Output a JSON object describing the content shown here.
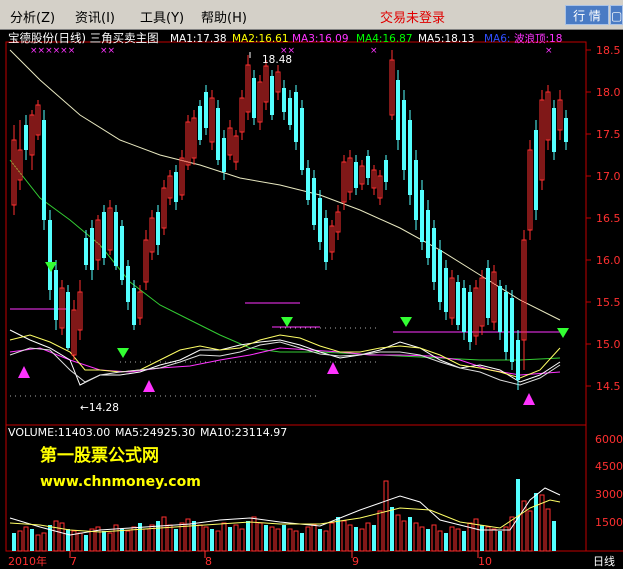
{
  "menu": {
    "items": [
      "分析(Z)",
      "资讯(I)",
      "工具(Y)",
      "帮助(H)"
    ],
    "login_status": "交易未登录",
    "right_buttons": [
      "行 情",
      "▢"
    ]
  },
  "header": {
    "title": "宝德股份(日线) 三角买卖主图",
    "ma": [
      {
        "label": "MA1:17.38",
        "color": "#ffffff"
      },
      {
        "label": "MA2:16.61",
        "color": "#ffff00"
      },
      {
        "label": "MA3:16.09",
        "color": "#ff33ff"
      },
      {
        "label": "MA4:16.87",
        "color": "#00ff00"
      },
      {
        "label": "MA5:18.13",
        "color": "#ffffff"
      },
      {
        "label": "MA6:",
        "color": "#2f4fff"
      },
      {
        "label": "波浪顶:18",
        "color": "#ff33ff"
      }
    ]
  },
  "price_axis": [
    "18.5",
    "18.0",
    "17.5",
    "17.0",
    "16.5",
    "16.0",
    "15.5",
    "15.0",
    "14.5"
  ],
  "annotations": {
    "high": "18.48",
    "low": "14.28"
  },
  "volume": {
    "header": [
      "VOLUME:11403.00",
      "MA5:24925.30",
      "MA10:23114.97"
    ],
    "axis": [
      "6000",
      "4500",
      "3000",
      "1500"
    ]
  },
  "date_axis": [
    "2010年",
    "7",
    "8",
    "9",
    "10",
    "日线"
  ],
  "watermark": {
    "line1": "第一股票公式网",
    "line2": "www.chnmoney.com"
  },
  "colors": {
    "up": "#ff3030",
    "down": "#54ffff",
    "axis": "#c00000",
    "buy_marker": "#ff33ff",
    "sell_marker": "#33ff33"
  }
}
